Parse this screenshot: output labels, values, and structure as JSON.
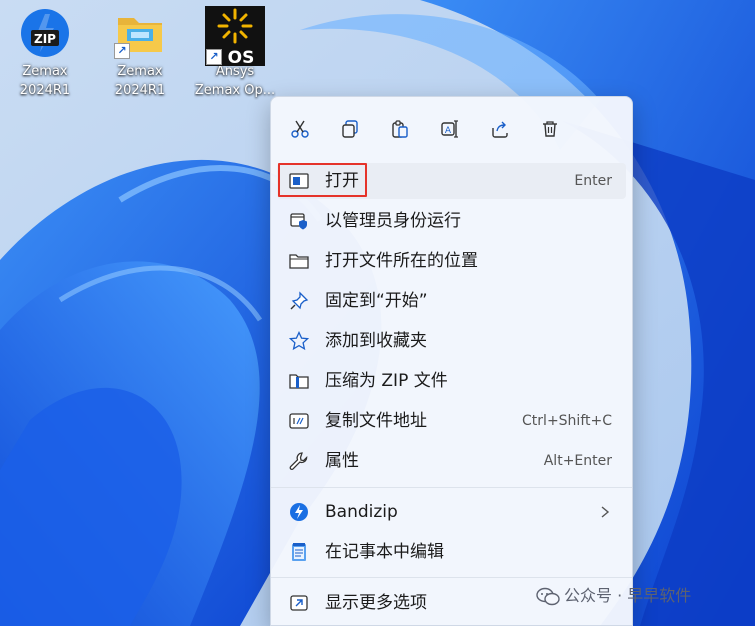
{
  "desktop": {
    "icons": [
      {
        "label1": "Zemax",
        "label2": "2024R1",
        "icon": "zip-archive-icon"
      },
      {
        "label1": "Zemax",
        "label2": "2024R1",
        "icon": "folder-icon"
      },
      {
        "label1": "Ansys",
        "label2": "Zemax Op...",
        "icon": "ansys-opticstudio-icon",
        "badge": "OS"
      }
    ]
  },
  "context_menu": {
    "toolbar": [
      {
        "name": "cut",
        "icon": "scissors-icon"
      },
      {
        "name": "copy",
        "icon": "copy-icon"
      },
      {
        "name": "paste",
        "icon": "clipboard-icon"
      },
      {
        "name": "rename",
        "icon": "rename-icon"
      },
      {
        "name": "share",
        "icon": "share-icon"
      },
      {
        "name": "delete",
        "icon": "trash-icon"
      }
    ],
    "items": [
      {
        "label": "打开",
        "shortcut": "Enter",
        "icon": "open-window-icon"
      },
      {
        "label": "以管理员身份运行",
        "shortcut": "",
        "icon": "admin-shield-icon"
      },
      {
        "label": "打开文件所在的位置",
        "shortcut": "",
        "icon": "folder-outline-icon"
      },
      {
        "label": "固定到“开始”",
        "shortcut": "",
        "icon": "pin-icon"
      },
      {
        "label": "添加到收藏夹",
        "shortcut": "",
        "icon": "star-icon"
      },
      {
        "label": "压缩为 ZIP 文件",
        "shortcut": "",
        "icon": "zip-folder-icon"
      },
      {
        "label": "复制文件地址",
        "shortcut": "Ctrl+Shift+C",
        "icon": "copy-path-icon"
      },
      {
        "label": "属性",
        "shortcut": "Alt+Enter",
        "icon": "wrench-icon"
      },
      {
        "label": "Bandizip",
        "shortcut": "",
        "icon": "bandizip-icon",
        "submenu": true
      },
      {
        "label": "在记事本中编辑",
        "shortcut": "",
        "icon": "notepad-icon"
      },
      {
        "label": "显示更多选项",
        "shortcut": "",
        "icon": "show-more-icon"
      }
    ]
  },
  "watermark": {
    "text": "公众号 · 早早软件",
    "icon": "wechat-icon"
  },
  "colors": {
    "accent": "#1a5fc9",
    "highlight_box": "#e5332a",
    "menu_bg": "#f4f7fd"
  }
}
